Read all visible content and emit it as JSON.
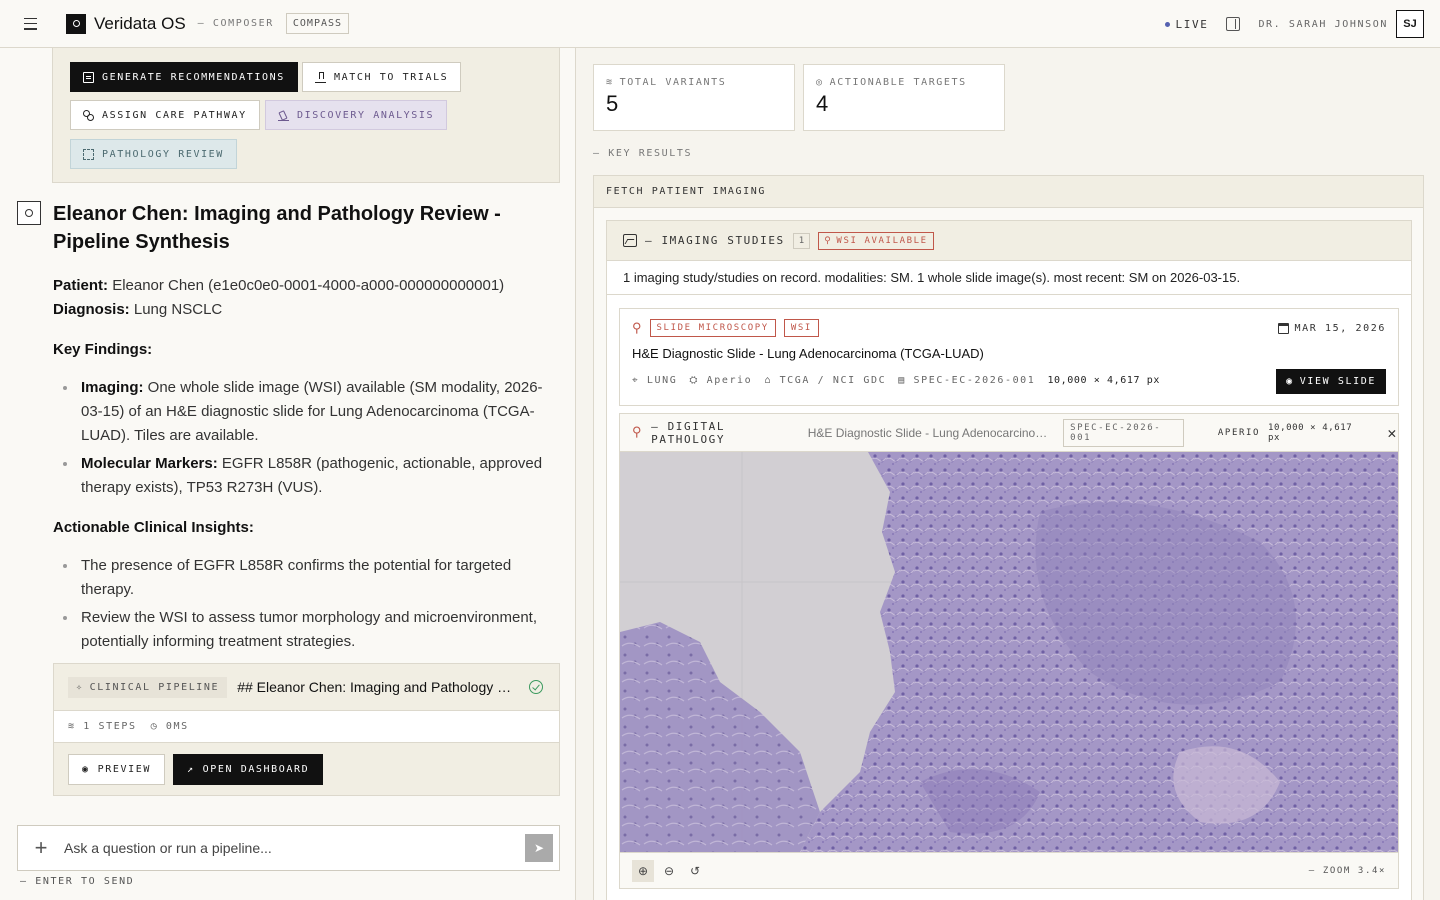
{
  "topbar": {
    "app_title": "Veridata OS",
    "nav_composer": "— COMPOSER",
    "nav_compass": "COMPASS",
    "live": "LIVE",
    "user_name": "DR. SARAH JOHNSON",
    "avatar": "SJ"
  },
  "actions": {
    "generate": "GENERATE RECOMMENDATIONS",
    "match": "MATCH TO TRIALS",
    "assign": "ASSIGN CARE PATHWAY",
    "discovery": "DISCOVERY ANALYSIS",
    "pathology": "PATHOLOGY REVIEW"
  },
  "message": {
    "title": "Eleanor Chen: Imaging and Pathology Review - Pipeline Synthesis",
    "patient_label": "Patient:",
    "patient_value": "Eleanor Chen (e1e0c0e0-0001-4000-a000-000000000001)",
    "diagnosis_label": "Diagnosis:",
    "diagnosis_value": "Lung NSCLC",
    "key_findings": "Key Findings:",
    "findings": [
      {
        "label": "Imaging:",
        "text": "One whole slide image (WSI) available (SM modality, 2026-03-15) of an H&E diagnostic slide for Lung Adenocarcinoma (TCGA-LUAD). Tiles are available."
      },
      {
        "label": "Molecular Markers:",
        "text": "EGFR L858R (pathogenic, actionable, approved therapy exists), TP53 R273H (VUS)."
      }
    ],
    "insights_heading": "Actionable Clinical Insights:",
    "insights": [
      "The presence of EGFR L858R confirms the potential for targeted therapy.",
      "Review the WSI to assess tumor morphology and microenvironment, potentially informing treatment strategies."
    ]
  },
  "pipeline": {
    "tag": "CLINICAL PIPELINE",
    "title": "## Eleanor Chen: Imaging and Pathology Review - Pipeline Synthesis",
    "steps": "1 STEPS",
    "duration": "0MS",
    "preview": "PREVIEW",
    "open_dashboard": "OPEN DASHBOARD"
  },
  "composer": {
    "placeholder": "Ask a question or run a pipeline...",
    "hint": "— ENTER TO SEND"
  },
  "stats": {
    "total_variants_label": "TOTAL VARIANTS",
    "total_variants": "5",
    "actionable_label": "ACTIONABLE TARGETS",
    "actionable": "4"
  },
  "key_results": "— KEY RESULTS",
  "fetch": {
    "title": "FETCH PATIENT IMAGING",
    "studies_label": "— IMAGING STUDIES",
    "studies_count": "1",
    "wsi_badge": "WSI AVAILABLE",
    "summary": "1 imaging study/studies on record. modalities: SM. 1 whole slide image(s). most recent: SM on 2026-03-15."
  },
  "study": {
    "tag_modality": "SLIDE MICROSCOPY",
    "tag_wsi": "WSI",
    "date": "MAR 15, 2026",
    "title": "H&E Diagnostic Slide - Lung Adenocarcinoma (TCGA-LUAD)",
    "site": "LUNG",
    "scanner": "Aperio",
    "source": "TCGA / NCI GDC",
    "specimen": "SPEC-EC-2026-001",
    "dimensions": "10,000 × 4,617 px",
    "view_button": "VIEW SLIDE"
  },
  "pathology": {
    "label": "— DIGITAL PATHOLOGY",
    "subtitle": "H&E Diagnostic Slide - Lung Adenocarcinoma (TCGA-LUAD)",
    "specimen": "SPEC-EC-2026-001",
    "scanner": "APERIO",
    "dimensions": "10,000 × 4,617 px",
    "zoom": "— ZOOM 3.4×"
  },
  "colors": {
    "accent_red": "#c0574a",
    "live_dot": "#5561b0",
    "success": "#3c9a5f",
    "tissue": "#9d8fc3"
  }
}
